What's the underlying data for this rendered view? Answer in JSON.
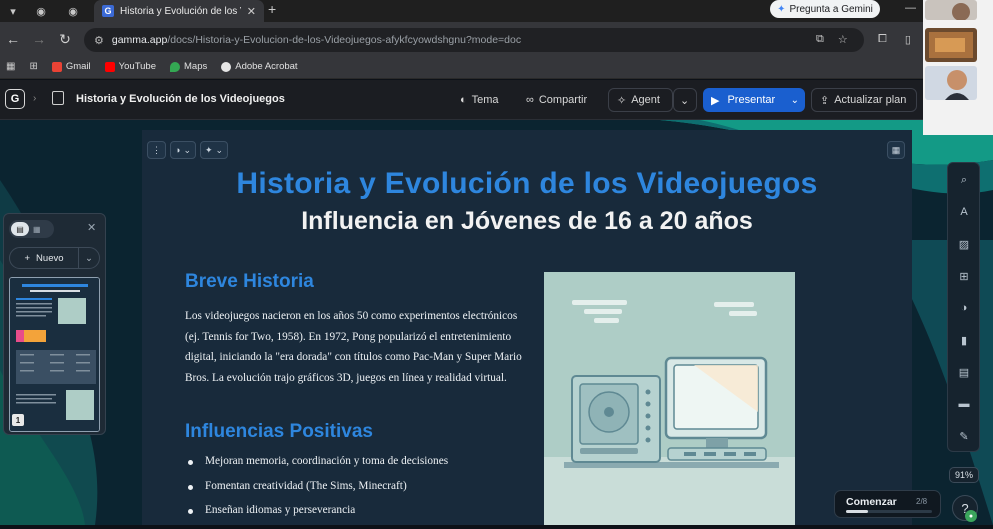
{
  "browser": {
    "tab_title": "Historia y Evolución de los Vide",
    "gemini_button": "Pregunta a Gemini",
    "url_host": "gamma.app",
    "url_path": "/docs/Historia-y-Evolucion-de-los-Videojuegos-afykfcyowdshgnu?mode=doc",
    "bookmarks": [
      "Gmail",
      "YouTube",
      "Maps",
      "Adobe Acrobat"
    ]
  },
  "header": {
    "logo_letter": "G",
    "doc_title": "Historia y Evolución de los Videojuegos",
    "tema": "Tema",
    "compartir": "Compartir",
    "agent": "Agent",
    "presentar": "Presentar",
    "actualizar": "Actualizar plan"
  },
  "slide": {
    "title": "Historia y Evolución de los Videojuegos",
    "subtitle": "Influencia en Jóvenes de 16 a 20 años",
    "section1_title": "Breve Historia",
    "section1_text": "Los videojuegos nacieron en los años 50 como experimentos electrónicos (ej. Tennis for Two, 1958). En 1972, Pong popularizó el entretenimiento digital, iniciando la \"era dorada\" con títulos como Pac-Man y Super Mario Bros. La evolución trajo gráficos 3D, juegos en línea y realidad virtual.",
    "section2_title": "Influencias Positivas",
    "bullets": [
      "Mejoran memoria, coordinación y toma de decisiones",
      "Fomentan creatividad (The Sims, Minecraft)",
      "Enseñan idiomas y perseverancia"
    ]
  },
  "left_panel": {
    "new_button": "Nuevo",
    "thumb_number": "1"
  },
  "right_toolbar": {
    "zoom": "91%",
    "help": "?"
  },
  "onboarding": {
    "label": "Comenzar",
    "progress_text": "2/8",
    "progress_fraction": 0.25
  },
  "colors": {
    "accent_blue": "#2e86de",
    "present_blue": "#1a5fcf",
    "card_bg": "#182a3b",
    "illustration_bg": "#aecdc6"
  },
  "icons": {
    "tema": "palette-icon",
    "compartir": "link-icon",
    "agent": "sparkle-icon",
    "presentar": "play-icon"
  }
}
